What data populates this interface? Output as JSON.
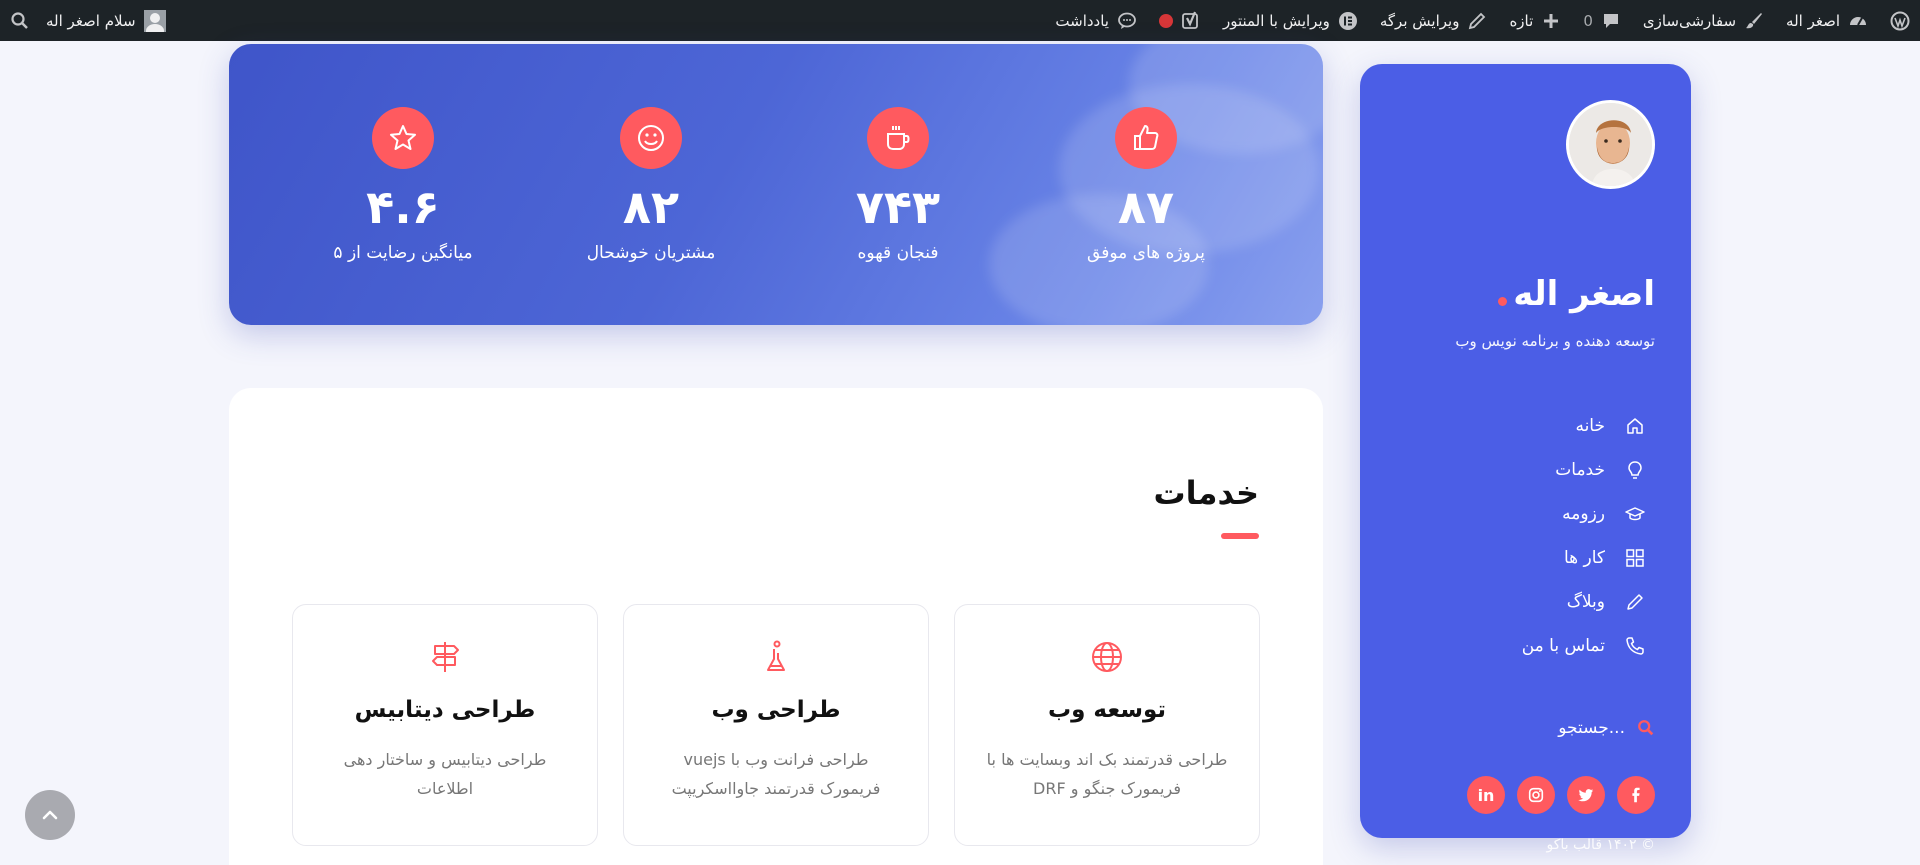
{
  "adminbar": {
    "site_name": "اصغر اله",
    "customize": "سفارشی‌سازی",
    "comments_count": "0",
    "new": "تازه",
    "edit_page": "ویرایش برگه",
    "edit_elementor": "ویرایش با المنتور",
    "notes": "یادداشت",
    "greeting": "سلام اصغر اله"
  },
  "profile": {
    "name": "اصغر اله",
    "role": "توسعه دهنده و برنامه نویس وب"
  },
  "nav": {
    "items": [
      {
        "label": "خانه",
        "icon": "home-icon"
      },
      {
        "label": "خدمات",
        "icon": "lightbulb-icon"
      },
      {
        "label": "رزومه",
        "icon": "graduation-cap-icon"
      },
      {
        "label": "کار ها",
        "icon": "grid-icon"
      },
      {
        "label": "وبلاگ",
        "icon": "pencil-icon"
      },
      {
        "label": "تماس با من",
        "icon": "phone-icon"
      }
    ]
  },
  "search": {
    "label": "جستجو..."
  },
  "social": {
    "linkedin": "in"
  },
  "copyright": "© ۱۴۰۲ قالب باکو",
  "stats": {
    "items": [
      {
        "value": "۸۷",
        "label": "پروژه های موفق",
        "icon": "thumbs-up-icon"
      },
      {
        "value": "۷۴۳",
        "label": "فنجان قهوه",
        "icon": "coffee-cup-icon"
      },
      {
        "value": "۸۲",
        "label": "مشتریان خوشحال",
        "icon": "smile-icon"
      },
      {
        "value": "۴.۶",
        "label": "میانگین رضایت از ۵",
        "icon": "star-icon"
      }
    ]
  },
  "services": {
    "title": "خدمات",
    "items": [
      {
        "title": "توسعه وب",
        "desc": "طراحی قدرتمند بک اند وبسایت ها با فریمورک جنگو و DRF",
        "icon": "globe-icon"
      },
      {
        "title": "طراحی وب",
        "desc": "طراحی فرانت وب با vuejs فریمورک قدرتمند جاوااسکریپت",
        "icon": "flask-icon"
      },
      {
        "title": "طراحی دیتابیس",
        "desc": "طراحی دیتابیس و ساختار دهی اطلاعات",
        "icon": "signpost-icon"
      }
    ]
  },
  "colors": {
    "accent": "#ff5a5f",
    "primary": "#4b5ee6",
    "adminbar": "#1d2327"
  }
}
